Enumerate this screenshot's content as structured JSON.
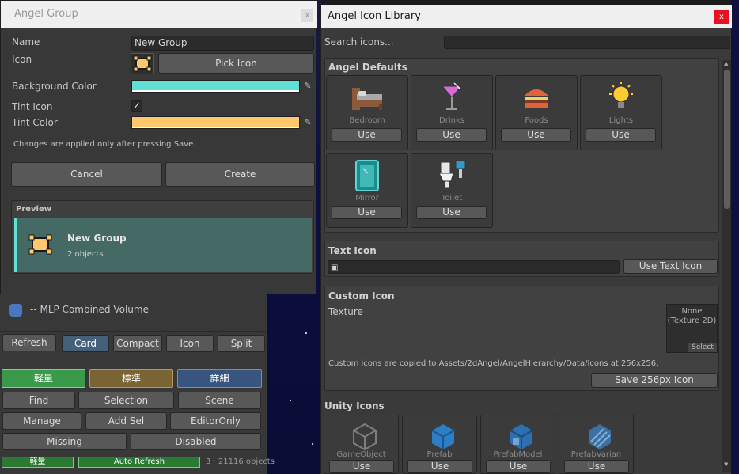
{
  "background_panel": {
    "list_item_label": "-- MLP Combined Volume",
    "toolbar": [
      "Refresh",
      "Card",
      "Compact",
      "Icon",
      "Split"
    ],
    "tags": [
      "軽量",
      "標準",
      "詳細"
    ],
    "row1": [
      "Find",
      "Selection",
      "Scene"
    ],
    "row2": [
      "Manage",
      "Add Sel",
      "EditorOnly"
    ],
    "row3": [
      "Missing",
      "Disabled"
    ],
    "status": {
      "tag": "軽量",
      "auto_refresh": "Auto Refresh",
      "count": "3 · 21116 objects"
    }
  },
  "dialog": {
    "title": "Angel Group",
    "close": "x",
    "name_label": "Name",
    "name_value": "New Group",
    "icon_label": "Icon",
    "pick_icon": "Pick Icon",
    "bg_color_label": "Background Color",
    "bg_color": "#5fe0d2",
    "tint_icon_label": "Tint Icon",
    "tint_icon_checked": "✓",
    "tint_color_label": "Tint Color",
    "tint_color": "#ffc86a",
    "note": "Changes are applied only after pressing Save.",
    "cancel": "Cancel",
    "create": "Create",
    "preview_label": "Preview",
    "preview_name": "New Group",
    "preview_count": "2 objects"
  },
  "library": {
    "title": "Angel Icon Library",
    "close": "x",
    "search_label": "Search icons...",
    "search_value": "",
    "angel_defaults": {
      "title": "Angel Defaults",
      "items": [
        {
          "name": "Bedroom",
          "icon": "bed-icon",
          "use": "Use"
        },
        {
          "name": "Drinks",
          "icon": "cocktail-icon",
          "use": "Use"
        },
        {
          "name": "Foods",
          "icon": "burger-icon",
          "use": "Use"
        },
        {
          "name": "Lights",
          "icon": "bulb-icon",
          "use": "Use"
        },
        {
          "name": "Mirror",
          "icon": "mirror-icon",
          "use": "Use"
        },
        {
          "name": "Toilet",
          "icon": "toilet-icon",
          "use": "Use"
        }
      ]
    },
    "text_icon": {
      "title": "Text Icon",
      "value": "▣",
      "button": "Use Text Icon"
    },
    "custom_icon": {
      "title": "Custom Icon",
      "texture_label": "Texture",
      "texture_none": "None\n(Texture 2D)",
      "select": "Select",
      "note": "Custom icons are copied to Assets/2dAngel/AngelHierarchy/Data/Icons at 256x256.",
      "save": "Save 256px Icon"
    },
    "unity_icons": {
      "title": "Unity Icons",
      "items": [
        {
          "name": "GameObject",
          "icon": "gameobject-icon",
          "use": "Use"
        },
        {
          "name": "Prefab",
          "icon": "prefab-icon",
          "use": "Use"
        },
        {
          "name": "PrefabModel",
          "icon": "prefab-model-icon",
          "use": "Use"
        },
        {
          "name": "PrefabVarian",
          "icon": "prefab-variant-icon",
          "use": "Use"
        }
      ]
    }
  },
  "colors": {
    "accent": "#46607c",
    "tag_green": "#3a9a4a",
    "tag_gold": "#7a6434",
    "tag_blue": "#37557e"
  }
}
